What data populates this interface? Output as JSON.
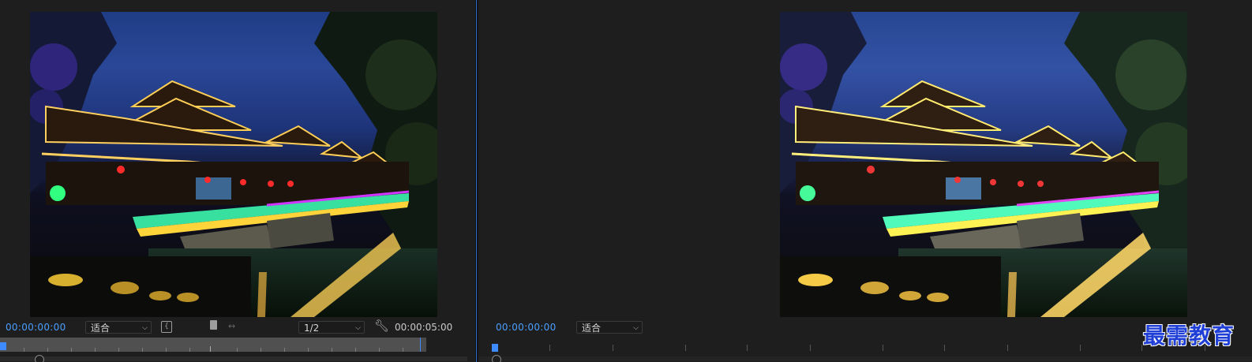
{
  "source_monitor": {
    "timecode": "00:00:00:00",
    "zoom_select": "适合",
    "resolution_select": "1/2",
    "duration": "00:00:05:00",
    "preview_alt": ""
  },
  "program_monitor": {
    "timecode": "00:00:00:00",
    "zoom_select": "适合"
  },
  "watermark": "最需教育",
  "colors": {
    "accent_blue": "#4a9eff",
    "panel_bg": "#1e1e1e",
    "watermark": "#1f3fd6"
  },
  "icons": {
    "chevron": "chevron-down-icon",
    "settings": "wrench-icon",
    "mark_in": "bracket-icon",
    "safe_margin": "safe-margin-icon",
    "trim": "trim-icon"
  }
}
